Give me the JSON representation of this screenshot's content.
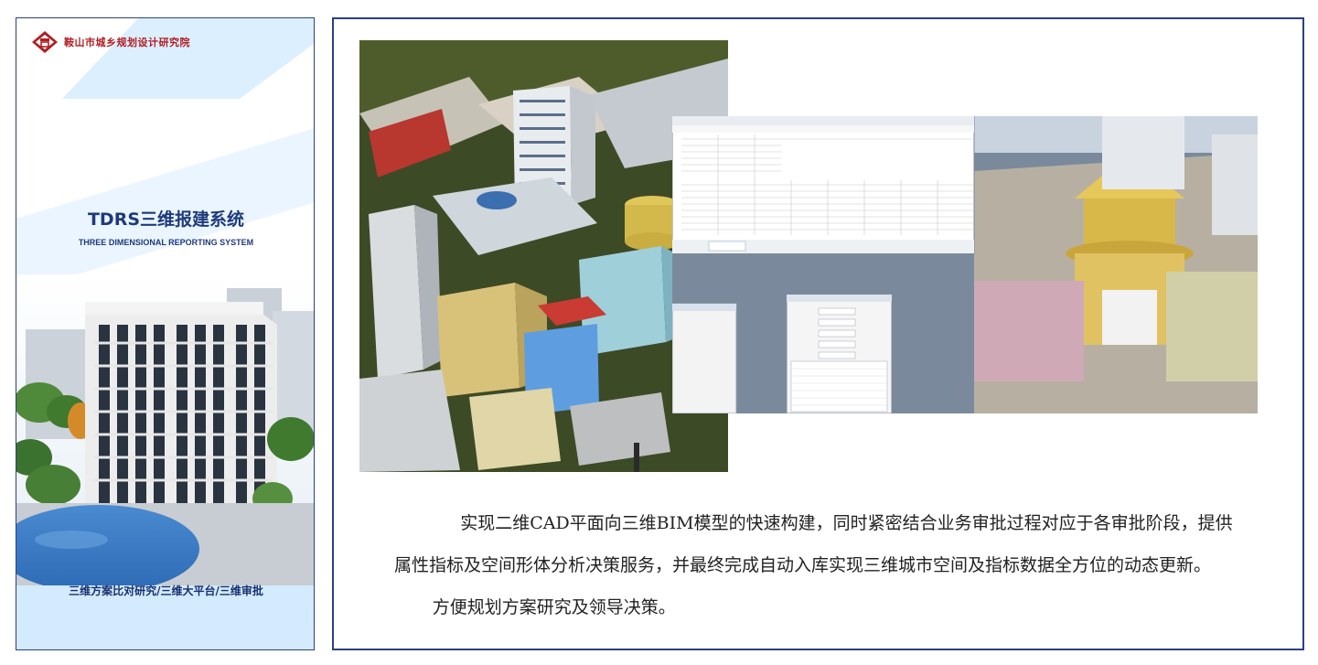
{
  "left_panel": {
    "org_name": "鞍山市城乡规划设计研究院",
    "system_title": "TDRS三维报建系统",
    "system_subtitle": "THREE DIMENSIONAL REPORTING SYSTEM",
    "tagline": "三维方案比对研究/三维大平台/三维审批"
  },
  "right_panel": {
    "paragraphs": [
      "实现二维CAD平面向三维BIM模型的快速构建，同时紧密结合业务审批过程对应于各审批阶段，提供属性指标及空间形体分析决策服务，并最终完成自动入库实现三维城市空间及指标数据全方位的动态更新。",
      "方便规划方案研究及领导决策。"
    ]
  },
  "colors": {
    "border": "#2b3f86",
    "title": "#1f3a7a",
    "org_red": "#b01e23",
    "light_blue": "#dcefff"
  }
}
